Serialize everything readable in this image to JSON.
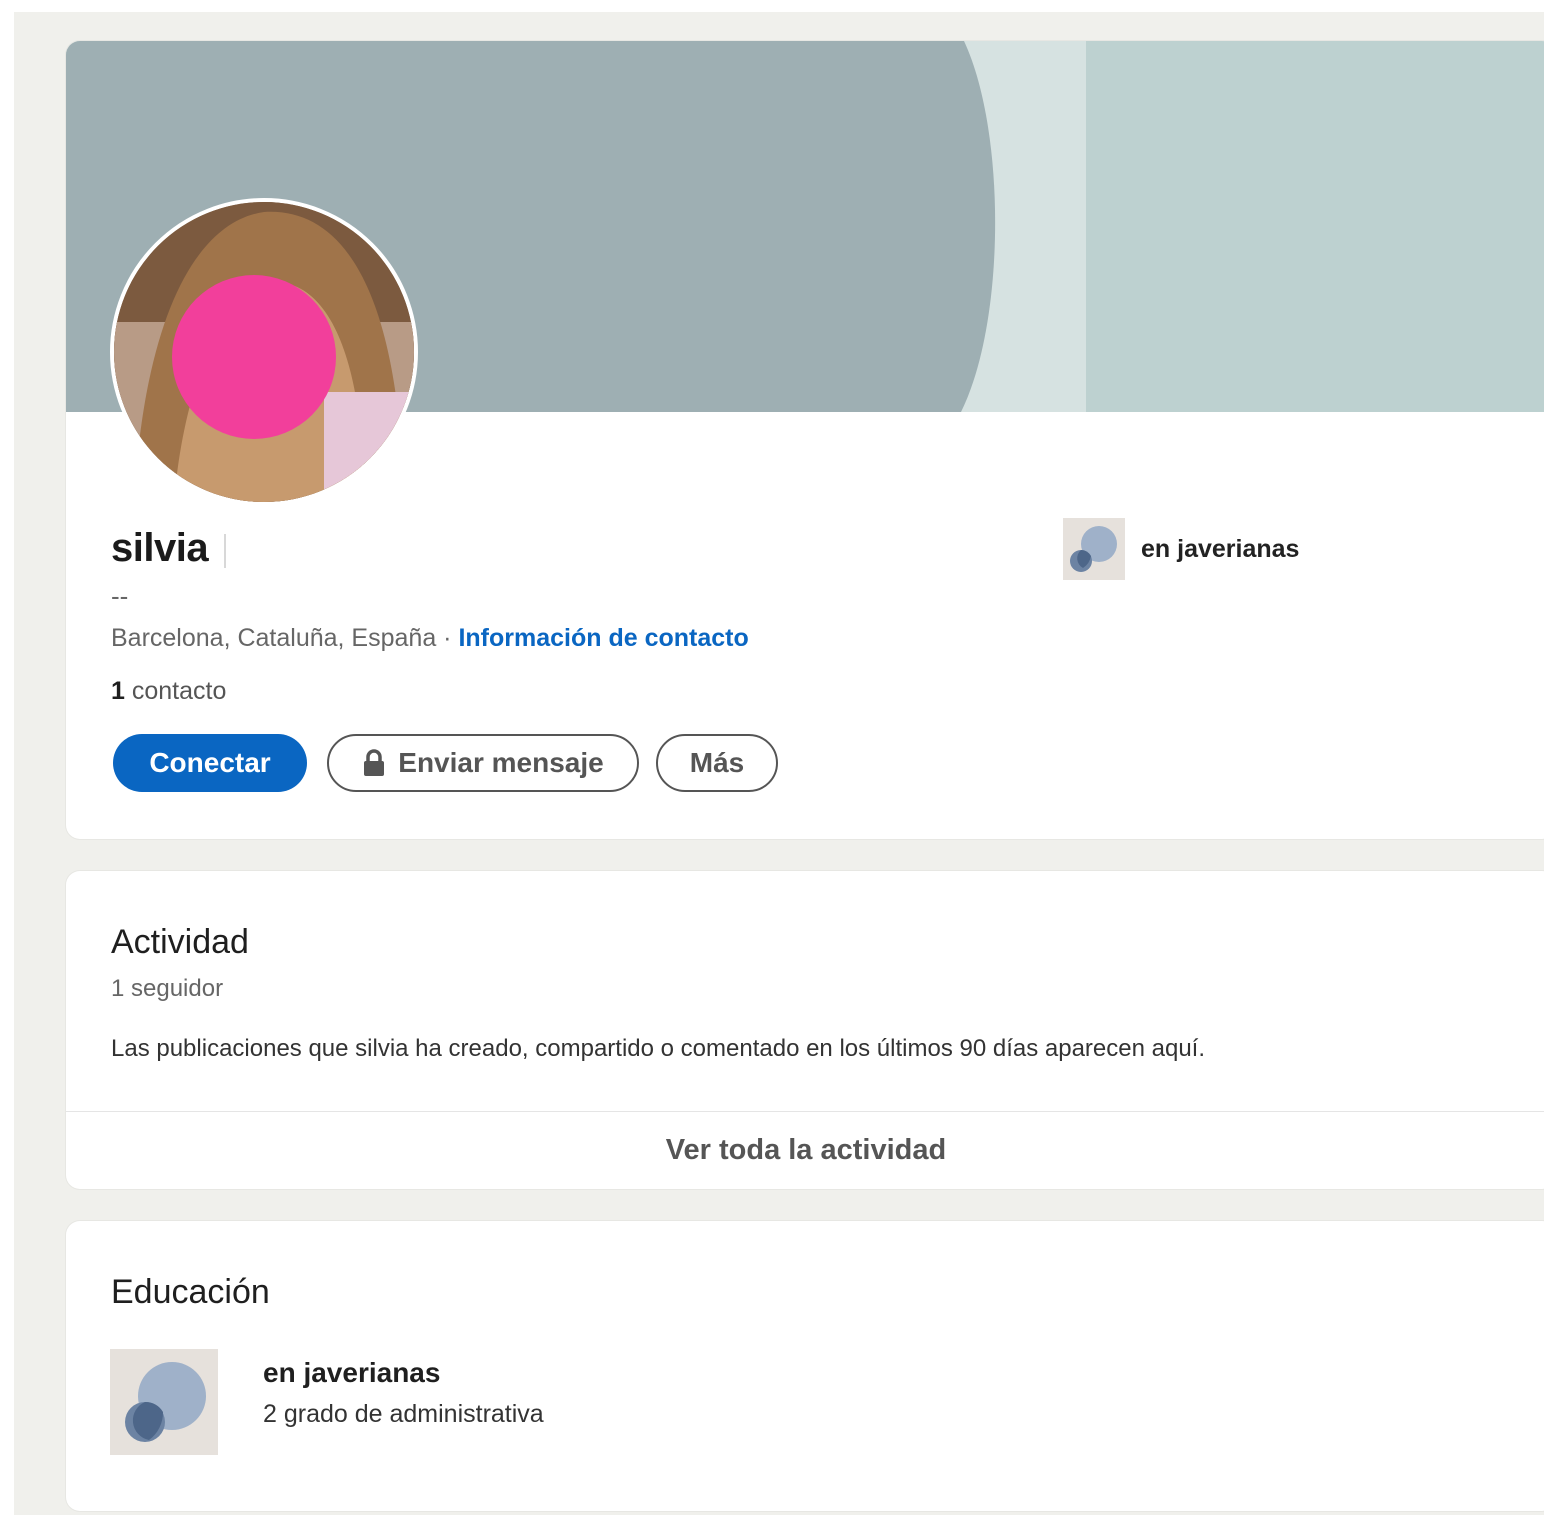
{
  "profile": {
    "name": "silvia",
    "headline": "--",
    "location": "Barcelona, Cataluña, España",
    "separator": " · ",
    "contact_info_label": "Información de contacto",
    "connections_count": "1",
    "connections_label": " contacto",
    "current_education": "en javerianas"
  },
  "actions": {
    "connect_label": "Conectar",
    "message_label": "Enviar mensaje",
    "more_label": "Más"
  },
  "activity": {
    "title": "Actividad",
    "followers": "1 seguidor",
    "description": "Las publicaciones que silvia ha creado, compartido o comentado en los últimos 90 días aparecen aquí.",
    "see_all_label": "Ver toda la actividad"
  },
  "education": {
    "title": "Educación",
    "school": "en javerianas",
    "degree": "2 grado de administrativa"
  },
  "colors": {
    "primary": "#0a66c2",
    "banner": "#9eafb3",
    "banner_light": "#bdd1d0",
    "avatar_redaction": "#f23f9b"
  },
  "icons": {
    "lock": "lock-icon",
    "school_logo": "school-logo-icon"
  }
}
